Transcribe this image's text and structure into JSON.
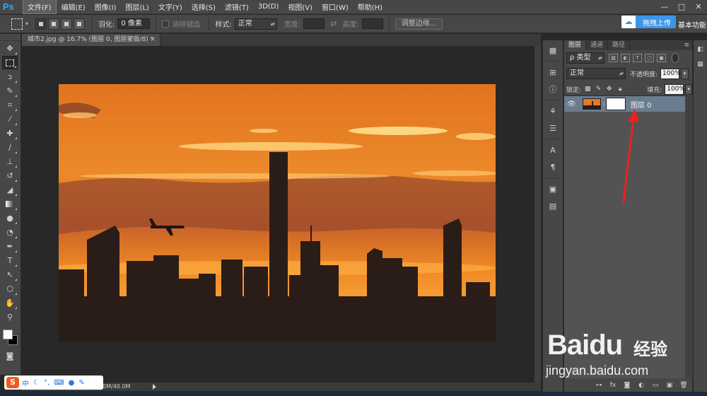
{
  "app": {
    "logo": "Ps"
  },
  "menu": [
    {
      "label": "文件(F)",
      "active": true
    },
    {
      "label": "编辑(E)"
    },
    {
      "label": "图像(I)"
    },
    {
      "label": "图层(L)"
    },
    {
      "label": "文字(Y)"
    },
    {
      "label": "选择(S)"
    },
    {
      "label": "滤镜(T)"
    },
    {
      "label": "3D(D)"
    },
    {
      "label": "视图(V)"
    },
    {
      "label": "窗口(W)"
    },
    {
      "label": "帮助(H)"
    }
  ],
  "window_controls": {
    "minimize": "—",
    "maximize": "□",
    "close": "✕"
  },
  "options": {
    "feather_label": "羽化:",
    "feather_value": "0 像素",
    "antialias_label": "消除锯齿",
    "style_label": "样式:",
    "style_value": "正常",
    "width_label": "宽度:",
    "height_label": "高度:",
    "refine_edge": "调整边缘..."
  },
  "upload": {
    "label": "拖拽上传"
  },
  "workspace": {
    "label": "基本功能"
  },
  "document": {
    "tab_title": "城市2.jpg @ 16.7% (图层 0, 图层蒙版/8) *",
    "close": "×",
    "status": "0M/40.0M"
  },
  "layers_panel": {
    "tabs": [
      "图层",
      "通道",
      "路径"
    ],
    "filter_kind": "ρ 类型",
    "blend_mode": "正常",
    "opacity_label": "不透明度:",
    "opacity_value": "100%",
    "lock_label": "锁定:",
    "fill_label": "填充:",
    "fill_value": "100%",
    "layer_name": "图层 0"
  },
  "ime": {
    "logo": "S",
    "mode": "中"
  },
  "watermark": {
    "brand": "Baidu",
    "cn": "经验",
    "site": "jingyan.baidu.com"
  },
  "colors": {
    "accent": "#31a8ff",
    "selected_layer": "#6a7d8e",
    "annotation": "#e8231c",
    "upload": "#3d95ea"
  }
}
